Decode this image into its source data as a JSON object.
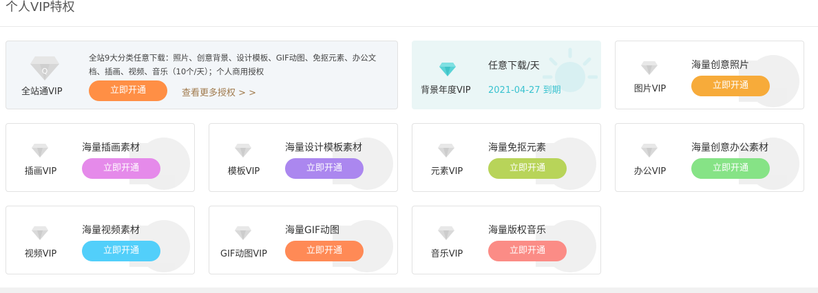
{
  "page": {
    "title": "个人VIP特权"
  },
  "all_site": {
    "name": "全站通VIP",
    "desc": "全站9大分类任意下载：照片、创意背景、设计模板、GIF动图、免抠元素、办公文档、插画、视频、音乐（10个/天）；个人商用授权",
    "button": "立即开通",
    "button_color": "#ff8f45",
    "more_link": "查看更多授权 > >"
  },
  "background_annual": {
    "name": "背景年度VIP",
    "desc": "任意下载/天",
    "expire": "2021-04-27 到期",
    "accent": "#39c2cf"
  },
  "vip_cards": [
    {
      "name": "图片VIP",
      "desc": "海量创意照片",
      "button": "立即开通",
      "color": "#f7ab3a"
    },
    {
      "name": "插画VIP",
      "desc": "海量插画素材",
      "button": "立即开通",
      "color": "#e58aea"
    },
    {
      "name": "模板VIP",
      "desc": "海量设计模板素材",
      "button": "立即开通",
      "color": "#ab87ef"
    },
    {
      "name": "元素VIP",
      "desc": "海量免抠元素",
      "button": "立即开通",
      "color": "#b8d459"
    },
    {
      "name": "办公VIP",
      "desc": "海量创意办公素材",
      "button": "立即开通",
      "color": "#86e386"
    },
    {
      "name": "视频VIP",
      "desc": "海量视频素材",
      "button": "立即开通",
      "color": "#52cffa"
    },
    {
      "name": "GIF动图VIP",
      "desc": "海量GIF动图",
      "button": "立即开通",
      "color": "#ff8a56"
    },
    {
      "name": "音乐VIP",
      "desc": "海量版权音乐",
      "button": "立即开通",
      "color": "#fb8c86"
    }
  ],
  "icons": {
    "vip_gem": "diamond-icon"
  }
}
